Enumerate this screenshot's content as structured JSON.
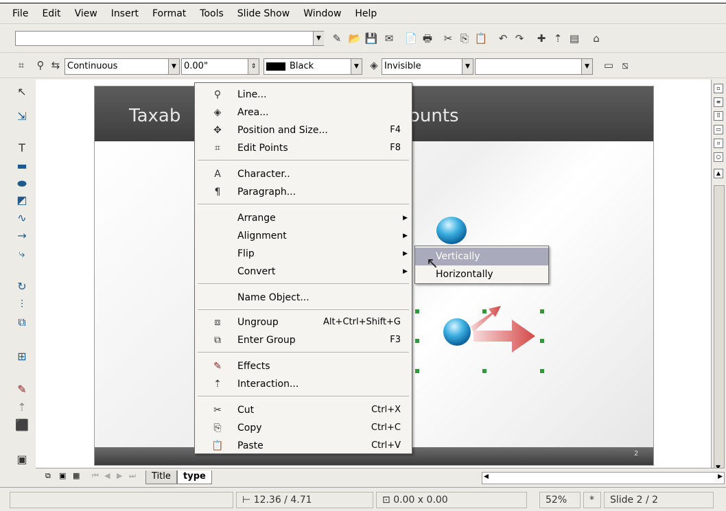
{
  "menubar": {
    "items": [
      "File",
      "Edit",
      "View",
      "Insert",
      "Format",
      "Tools",
      "Slide Show",
      "Window",
      "Help"
    ]
  },
  "toolbar_line": {
    "line_style": "Continuous",
    "line_width": "0.00\"",
    "line_color": "Black",
    "area_style": "Invisible",
    "area_value": ""
  },
  "slide": {
    "title_left": "Taxab",
    "title_right": "ounts",
    "number": "2"
  },
  "context_menu": {
    "items": [
      {
        "label": "Line...",
        "shortcut": "",
        "icon": "line-icon",
        "submenu": false
      },
      {
        "label": "Area...",
        "shortcut": "",
        "icon": "area-icon",
        "submenu": false
      },
      {
        "label": "Position and Size...",
        "shortcut": "F4",
        "icon": "position-size-icon",
        "submenu": false
      },
      {
        "label": "Edit Points",
        "shortcut": "F8",
        "icon": "edit-points-icon",
        "submenu": false
      },
      {
        "label": "Character..",
        "shortcut": "",
        "icon": "character-icon",
        "submenu": false
      },
      {
        "label": "Paragraph...",
        "shortcut": "",
        "icon": "paragraph-icon",
        "submenu": false
      },
      {
        "label": "Arrange",
        "shortcut": "",
        "icon": "",
        "submenu": true
      },
      {
        "label": "Alignment",
        "shortcut": "",
        "icon": "",
        "submenu": true
      },
      {
        "label": "Flip",
        "shortcut": "",
        "icon": "",
        "submenu": true
      },
      {
        "label": "Convert",
        "shortcut": "",
        "icon": "",
        "submenu": true
      },
      {
        "label": "Name Object...",
        "shortcut": "",
        "icon": "",
        "submenu": false
      },
      {
        "label": "Ungroup",
        "shortcut": "Alt+Ctrl+Shift+G",
        "icon": "ungroup-icon",
        "submenu": false
      },
      {
        "label": "Enter Group",
        "shortcut": "F3",
        "icon": "enter-group-icon",
        "submenu": false
      },
      {
        "label": "Effects",
        "shortcut": "",
        "icon": "effects-icon",
        "submenu": false
      },
      {
        "label": "Interaction...",
        "shortcut": "",
        "icon": "interaction-icon",
        "submenu": false
      },
      {
        "label": "Cut",
        "shortcut": "Ctrl+X",
        "icon": "cut-icon",
        "submenu": false
      },
      {
        "label": "Copy",
        "shortcut": "Ctrl+C",
        "icon": "copy-icon",
        "submenu": false
      },
      {
        "label": "Paste",
        "shortcut": "Ctrl+V",
        "icon": "paste-icon",
        "submenu": false
      }
    ]
  },
  "flip_submenu": {
    "items": [
      "Vertically",
      "Horizontally"
    ]
  },
  "tabs": {
    "items": [
      "Title",
      "type"
    ]
  },
  "statusbar": {
    "position": "12.36 / 4.71",
    "size": "0.00 x 0.00",
    "zoom": "52%",
    "modified": "*",
    "slide": "Slide 2 / 2"
  },
  "colors": {
    "menu_highlight": "#a9aabb",
    "selection_handle": "#2f9a3a",
    "slide_header": "#4a4a4a"
  }
}
